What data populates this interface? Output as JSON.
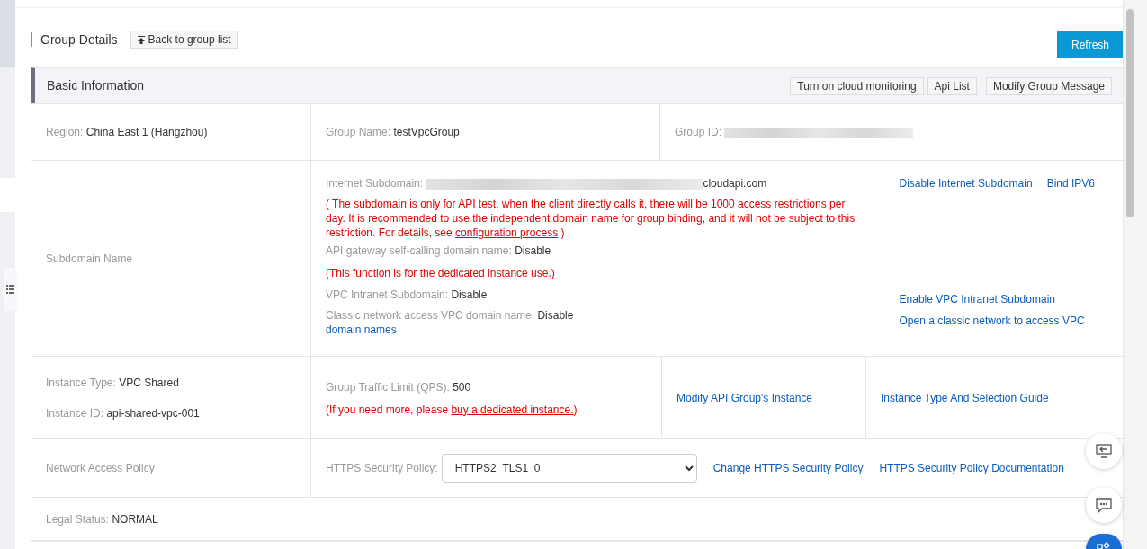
{
  "header": {
    "title": "Group Details",
    "back_button": "Back to group list",
    "refresh_button": "Refresh"
  },
  "basic_info": {
    "title": "Basic Information",
    "actions": [
      "Turn on cloud monitoring",
      "Api List",
      "Modify Group Message"
    ]
  },
  "region": {
    "label": "Region:",
    "value": "China East 1 (Hangzhou)"
  },
  "group_name": {
    "label": "Group Name:",
    "value": "testVpcGroup"
  },
  "group_id": {
    "label": "Group ID:"
  },
  "subdomain": {
    "title": "Subdomain Name",
    "internet": {
      "label": "Internet Subdomain:",
      "value_tail": "cloudapi.com",
      "links": [
        "Disable Internet Subdomain",
        "Bind IPV6"
      ]
    },
    "notice": {
      "text": "( The subdomain is only for API test, when the client directly calls it, there will be 1000 access restrictions per day. It is recommended to use the independent domain name for group binding, and it will not be subject to this restriction. For details, see ",
      "link": "configuration process",
      "tail": " )"
    },
    "self_calling": {
      "label": "API gateway self-calling domain name:",
      "value": "Disable"
    },
    "dedicated_note": "(This function is for the dedicated instance use.)",
    "vpc_intranet": {
      "label": "VPC Intranet Subdomain:",
      "value": "Disable",
      "link": "Enable VPC Intranet Subdomain"
    },
    "classic": {
      "label": "Classic network access VPC domain name:",
      "value": "Disable",
      "sub_link": "domain names",
      "link": "Open a classic network to access VPC"
    }
  },
  "instance": {
    "type_label": "Instance Type:",
    "type_value": "VPC Shared",
    "id_label": "Instance ID:",
    "id_value": "api-shared-vpc-001",
    "qps_label": "Group Traffic Limit (QPS):",
    "qps_value": "500",
    "qps_note": "(If you need more, please ",
    "qps_link": "buy a dedicated instance.",
    "qps_tail": ")",
    "modify_link": "Modify API Group's Instance",
    "guide_link": "Instance Type And Selection Guide"
  },
  "network": {
    "title": "Network Access Policy",
    "policy_label": "HTTPS Security Policy:",
    "policy_value": "HTTPS2_TLS1_0",
    "change_link": "Change HTTPS Security Policy",
    "doc_link": "HTTPS Security Policy Documentation"
  },
  "legal": {
    "label": "Legal Status:",
    "value": "NORMAL"
  }
}
